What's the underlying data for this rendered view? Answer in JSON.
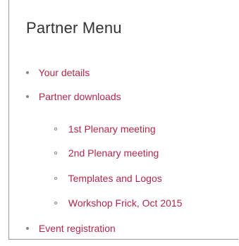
{
  "menu": {
    "title": "Partner Menu",
    "items": [
      {
        "label": "Your details"
      },
      {
        "label": "Partner downloads"
      },
      {
        "label": "1st Plenary meeting"
      },
      {
        "label": "2nd Plenary meeting"
      },
      {
        "label": "Templates and Logos"
      },
      {
        "label": "Workshop Frick, Oct 2015"
      },
      {
        "label": "Event registration"
      }
    ]
  },
  "colors": {
    "link": "#b0284b",
    "title": "#333333",
    "bullet": "#888888",
    "border": "#9a9a9a"
  }
}
